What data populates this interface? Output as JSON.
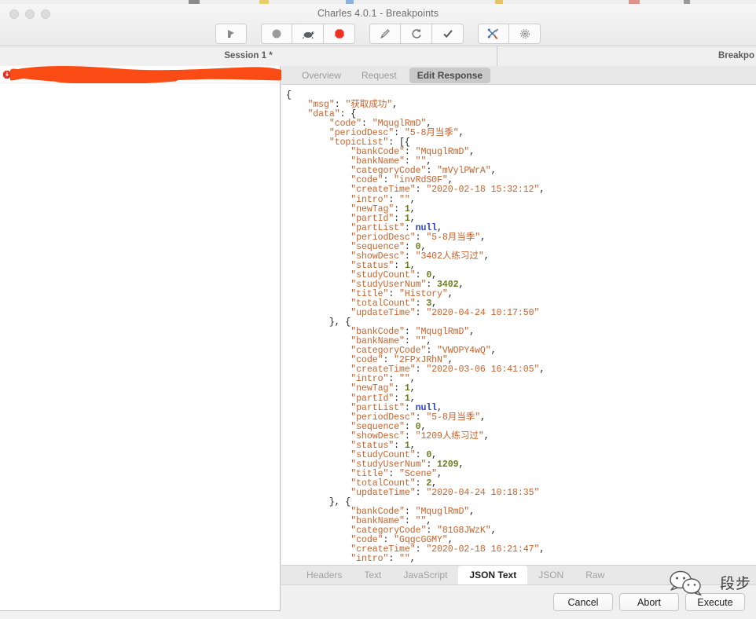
{
  "window": {
    "title": "Charles 4.0.1 - Breakpoints",
    "traffic_lights": [
      "close-button",
      "minimize-button",
      "zoom-button"
    ]
  },
  "toolbar": {
    "buttons": [
      {
        "name": "clear-icon",
        "label": "Clear"
      },
      {
        "name": "record-icon",
        "label": "Start/Stop Recording"
      },
      {
        "name": "throttle-icon",
        "label": "Throttle Settings"
      },
      {
        "name": "breakpoint-icon",
        "label": "Enable Breakpoints"
      },
      {
        "name": "compose-icon",
        "label": "Compose"
      },
      {
        "name": "repeat-icon",
        "label": "Repeat"
      },
      {
        "name": "validate-icon",
        "label": "Validate"
      },
      {
        "name": "tools-icon",
        "label": "Tools"
      },
      {
        "name": "settings-icon",
        "label": "Settings"
      }
    ]
  },
  "panes": {
    "session_tab": "Session 1 *",
    "breakpoints_tab": "Breakpo"
  },
  "session_list": {
    "rows": [
      {
        "label": "",
        "redacted": true,
        "has_breakpoint": true
      }
    ]
  },
  "inspector": {
    "tabs": [
      {
        "label": "Overview",
        "active": false
      },
      {
        "label": "Request",
        "active": false
      },
      {
        "label": "Edit Response",
        "active": true
      }
    ]
  },
  "format_tabs": [
    {
      "label": "Headers",
      "active": false
    },
    {
      "label": "Text",
      "active": false
    },
    {
      "label": "JavaScript",
      "active": false
    },
    {
      "label": "JSON Text",
      "active": true
    },
    {
      "label": "JSON",
      "active": false
    },
    {
      "label": "Raw",
      "active": false
    }
  ],
  "actions": {
    "cancel_label": "Cancel",
    "abort_label": "Abort",
    "execute_label": "Execute"
  },
  "watermark": {
    "text": "段步",
    "icon": "wechat-icon"
  },
  "colors": {
    "json_string": "#c8622b",
    "json_number": "#6a7d1f",
    "json_null": "#2b3fd0",
    "json_punct": "#1a1a1a",
    "redaction": "#fb4b14",
    "accent_active_tab": "#c9c9c9"
  },
  "json_body": {
    "msg": "获取成功",
    "data": {
      "code": "MquglRmD",
      "periodDesc": "5-8月当季",
      "topicList": [
        {
          "bankCode": "MquglRmD",
          "bankName": "",
          "categoryCode": "mVylPWrA",
          "code": "invRdS0F",
          "createTime": "2020-02-18 15:32:12",
          "intro": "",
          "newTag": 1,
          "partId": 1,
          "partList": null,
          "periodDesc": "5-8月当季",
          "sequence": 0,
          "showDesc": "3402人练习过",
          "status": 1,
          "studyCount": 0,
          "studyUserNum": 3402,
          "title": "History",
          "totalCount": 3,
          "updateTime": "2020-04-24 10:17:50"
        },
        {
          "bankCode": "MquglRmD",
          "bankName": "",
          "categoryCode": "VWOPY4wQ",
          "code": "2FPxJRhN",
          "createTime": "2020-03-06 16:41:05",
          "intro": "",
          "newTag": 1,
          "partId": 1,
          "partList": null,
          "periodDesc": "5-8月当季",
          "sequence": 0,
          "showDesc": "1209人练习过",
          "status": 1,
          "studyCount": 0,
          "studyUserNum": 1209,
          "title": "Scene",
          "totalCount": 2,
          "updateTime": "2020-04-24 10:18:35"
        },
        {
          "bankCode": "MquglRmD",
          "bankName": "",
          "categoryCode": "81G8JWzK",
          "code": "GqgcGGMY",
          "createTime": "2020-02-18 16:21:47",
          "intro": ""
        }
      ]
    }
  },
  "json_lines": [
    [
      [
        "pun",
        "{"
      ]
    ],
    [
      [
        "pun",
        "    "
      ],
      [
        "k",
        "\"msg\""
      ],
      [
        "pun",
        ": "
      ],
      [
        "s",
        "\"获取成功\""
      ],
      [
        "pun",
        ","
      ]
    ],
    [
      [
        "pun",
        "    "
      ],
      [
        "k",
        "\"data\""
      ],
      [
        "pun",
        ": {"
      ]
    ],
    [
      [
        "pun",
        "        "
      ],
      [
        "k",
        "\"code\""
      ],
      [
        "pun",
        ": "
      ],
      [
        "s",
        "\"MquglRmD\""
      ],
      [
        "pun",
        ","
      ]
    ],
    [
      [
        "pun",
        "        "
      ],
      [
        "k",
        "\"periodDesc\""
      ],
      [
        "pun",
        ": "
      ],
      [
        "s",
        "\"5-8月当季\""
      ],
      [
        "pun",
        ","
      ]
    ],
    [
      [
        "pun",
        "        "
      ],
      [
        "k",
        "\"topicList\""
      ],
      [
        "pun",
        ": [{"
      ]
    ],
    [
      [
        "pun",
        "            "
      ],
      [
        "k",
        "\"bankCode\""
      ],
      [
        "pun",
        ": "
      ],
      [
        "s",
        "\"MquglRmD\""
      ],
      [
        "pun",
        ","
      ]
    ],
    [
      [
        "pun",
        "            "
      ],
      [
        "k",
        "\"bankName\""
      ],
      [
        "pun",
        ": "
      ],
      [
        "s",
        "\"\""
      ],
      [
        "pun",
        ","
      ]
    ],
    [
      [
        "pun",
        "            "
      ],
      [
        "k",
        "\"categoryCode\""
      ],
      [
        "pun",
        ": "
      ],
      [
        "s",
        "\"mVylPWrA\""
      ],
      [
        "pun",
        ","
      ]
    ],
    [
      [
        "pun",
        "            "
      ],
      [
        "k",
        "\"code\""
      ],
      [
        "pun",
        ": "
      ],
      [
        "s",
        "\"invRdS0F\""
      ],
      [
        "pun",
        ","
      ]
    ],
    [
      [
        "pun",
        "            "
      ],
      [
        "k",
        "\"createTime\""
      ],
      [
        "pun",
        ": "
      ],
      [
        "s",
        "\"2020-02-18 15:32:12\""
      ],
      [
        "pun",
        ","
      ]
    ],
    [
      [
        "pun",
        "            "
      ],
      [
        "k",
        "\"intro\""
      ],
      [
        "pun",
        ": "
      ],
      [
        "s",
        "\"\""
      ],
      [
        "pun",
        ","
      ]
    ],
    [
      [
        "pun",
        "            "
      ],
      [
        "k",
        "\"newTag\""
      ],
      [
        "pun",
        ": "
      ],
      [
        "num",
        "1"
      ],
      [
        "pun",
        ","
      ]
    ],
    [
      [
        "pun",
        "            "
      ],
      [
        "k",
        "\"partId\""
      ],
      [
        "pun",
        ": "
      ],
      [
        "num",
        "1"
      ],
      [
        "pun",
        ","
      ]
    ],
    [
      [
        "pun",
        "            "
      ],
      [
        "k",
        "\"partList\""
      ],
      [
        "pun",
        ": "
      ],
      [
        "nul",
        "null"
      ],
      [
        "pun",
        ","
      ]
    ],
    [
      [
        "pun",
        "            "
      ],
      [
        "k",
        "\"periodDesc\""
      ],
      [
        "pun",
        ": "
      ],
      [
        "s",
        "\"5-8月当季\""
      ],
      [
        "pun",
        ","
      ]
    ],
    [
      [
        "pun",
        "            "
      ],
      [
        "k",
        "\"sequence\""
      ],
      [
        "pun",
        ": "
      ],
      [
        "num",
        "0"
      ],
      [
        "pun",
        ","
      ]
    ],
    [
      [
        "pun",
        "            "
      ],
      [
        "k",
        "\"showDesc\""
      ],
      [
        "pun",
        ": "
      ],
      [
        "s",
        "\"3402人练习过\""
      ],
      [
        "pun",
        ","
      ]
    ],
    [
      [
        "pun",
        "            "
      ],
      [
        "k",
        "\"status\""
      ],
      [
        "pun",
        ": "
      ],
      [
        "num",
        "1"
      ],
      [
        "pun",
        ","
      ]
    ],
    [
      [
        "pun",
        "            "
      ],
      [
        "k",
        "\"studyCount\""
      ],
      [
        "pun",
        ": "
      ],
      [
        "num",
        "0"
      ],
      [
        "pun",
        ","
      ]
    ],
    [
      [
        "pun",
        "            "
      ],
      [
        "k",
        "\"studyUserNum\""
      ],
      [
        "pun",
        ": "
      ],
      [
        "num",
        "3402"
      ],
      [
        "pun",
        ","
      ]
    ],
    [
      [
        "pun",
        "            "
      ],
      [
        "k",
        "\"title\""
      ],
      [
        "pun",
        ": "
      ],
      [
        "s",
        "\"History\""
      ],
      [
        "pun",
        ","
      ]
    ],
    [
      [
        "pun",
        "            "
      ],
      [
        "k",
        "\"totalCount\""
      ],
      [
        "pun",
        ": "
      ],
      [
        "num",
        "3"
      ],
      [
        "pun",
        ","
      ]
    ],
    [
      [
        "pun",
        "            "
      ],
      [
        "k",
        "\"updateTime\""
      ],
      [
        "pun",
        ": "
      ],
      [
        "s",
        "\"2020-04-24 10:17:50\""
      ]
    ],
    [
      [
        "pun",
        "        }, {"
      ]
    ],
    [
      [
        "pun",
        "            "
      ],
      [
        "k",
        "\"bankCode\""
      ],
      [
        "pun",
        ": "
      ],
      [
        "s",
        "\"MquglRmD\""
      ],
      [
        "pun",
        ","
      ]
    ],
    [
      [
        "pun",
        "            "
      ],
      [
        "k",
        "\"bankName\""
      ],
      [
        "pun",
        ": "
      ],
      [
        "s",
        "\"\""
      ],
      [
        "pun",
        ","
      ]
    ],
    [
      [
        "pun",
        "            "
      ],
      [
        "k",
        "\"categoryCode\""
      ],
      [
        "pun",
        ": "
      ],
      [
        "s",
        "\"VWOPY4wQ\""
      ],
      [
        "pun",
        ","
      ]
    ],
    [
      [
        "pun",
        "            "
      ],
      [
        "k",
        "\"code\""
      ],
      [
        "pun",
        ": "
      ],
      [
        "s",
        "\"2FPxJRhN\""
      ],
      [
        "pun",
        ","
      ]
    ],
    [
      [
        "pun",
        "            "
      ],
      [
        "k",
        "\"createTime\""
      ],
      [
        "pun",
        ": "
      ],
      [
        "s",
        "\"2020-03-06 16:41:05\""
      ],
      [
        "pun",
        ","
      ]
    ],
    [
      [
        "pun",
        "            "
      ],
      [
        "k",
        "\"intro\""
      ],
      [
        "pun",
        ": "
      ],
      [
        "s",
        "\"\""
      ],
      [
        "pun",
        ","
      ]
    ],
    [
      [
        "pun",
        "            "
      ],
      [
        "k",
        "\"newTag\""
      ],
      [
        "pun",
        ": "
      ],
      [
        "num",
        "1"
      ],
      [
        "pun",
        ","
      ]
    ],
    [
      [
        "pun",
        "            "
      ],
      [
        "k",
        "\"partId\""
      ],
      [
        "pun",
        ": "
      ],
      [
        "num",
        "1"
      ],
      [
        "pun",
        ","
      ]
    ],
    [
      [
        "pun",
        "            "
      ],
      [
        "k",
        "\"partList\""
      ],
      [
        "pun",
        ": "
      ],
      [
        "nul",
        "null"
      ],
      [
        "pun",
        ","
      ]
    ],
    [
      [
        "pun",
        "            "
      ],
      [
        "k",
        "\"periodDesc\""
      ],
      [
        "pun",
        ": "
      ],
      [
        "s",
        "\"5-8月当季\""
      ],
      [
        "pun",
        ","
      ]
    ],
    [
      [
        "pun",
        "            "
      ],
      [
        "k",
        "\"sequence\""
      ],
      [
        "pun",
        ": "
      ],
      [
        "num",
        "0"
      ],
      [
        "pun",
        ","
      ]
    ],
    [
      [
        "pun",
        "            "
      ],
      [
        "k",
        "\"showDesc\""
      ],
      [
        "pun",
        ": "
      ],
      [
        "s",
        "\"1209人练习过\""
      ],
      [
        "pun",
        ","
      ]
    ],
    [
      [
        "pun",
        "            "
      ],
      [
        "k",
        "\"status\""
      ],
      [
        "pun",
        ": "
      ],
      [
        "num",
        "1"
      ],
      [
        "pun",
        ","
      ]
    ],
    [
      [
        "pun",
        "            "
      ],
      [
        "k",
        "\"studyCount\""
      ],
      [
        "pun",
        ": "
      ],
      [
        "num",
        "0"
      ],
      [
        "pun",
        ","
      ]
    ],
    [
      [
        "pun",
        "            "
      ],
      [
        "k",
        "\"studyUserNum\""
      ],
      [
        "pun",
        ": "
      ],
      [
        "num",
        "1209"
      ],
      [
        "pun",
        ","
      ]
    ],
    [
      [
        "pun",
        "            "
      ],
      [
        "k",
        "\"title\""
      ],
      [
        "pun",
        ": "
      ],
      [
        "s",
        "\"Scene\""
      ],
      [
        "pun",
        ","
      ]
    ],
    [
      [
        "pun",
        "            "
      ],
      [
        "k",
        "\"totalCount\""
      ],
      [
        "pun",
        ": "
      ],
      [
        "num",
        "2"
      ],
      [
        "pun",
        ","
      ]
    ],
    [
      [
        "pun",
        "            "
      ],
      [
        "k",
        "\"updateTime\""
      ],
      [
        "pun",
        ": "
      ],
      [
        "s",
        "\"2020-04-24 10:18:35\""
      ]
    ],
    [
      [
        "pun",
        "        }, {"
      ]
    ],
    [
      [
        "pun",
        "            "
      ],
      [
        "k",
        "\"bankCode\""
      ],
      [
        "pun",
        ": "
      ],
      [
        "s",
        "\"MquglRmD\""
      ],
      [
        "pun",
        ","
      ]
    ],
    [
      [
        "pun",
        "            "
      ],
      [
        "k",
        "\"bankName\""
      ],
      [
        "pun",
        ": "
      ],
      [
        "s",
        "\"\""
      ],
      [
        "pun",
        ","
      ]
    ],
    [
      [
        "pun",
        "            "
      ],
      [
        "k",
        "\"categoryCode\""
      ],
      [
        "pun",
        ": "
      ],
      [
        "s",
        "\"81G8JWzK\""
      ],
      [
        "pun",
        ","
      ]
    ],
    [
      [
        "pun",
        "            "
      ],
      [
        "k",
        "\"code\""
      ],
      [
        "pun",
        ": "
      ],
      [
        "s",
        "\"GqgcGGMY\""
      ],
      [
        "pun",
        ","
      ]
    ],
    [
      [
        "pun",
        "            "
      ],
      [
        "k",
        "\"createTime\""
      ],
      [
        "pun",
        ": "
      ],
      [
        "s",
        "\"2020-02-18 16:21:47\""
      ],
      [
        "pun",
        ","
      ]
    ],
    [
      [
        "pun",
        "            "
      ],
      [
        "k",
        "\"intro\""
      ],
      [
        "pun",
        ": "
      ],
      [
        "s",
        "\"\""
      ],
      [
        "pun",
        ","
      ]
    ]
  ]
}
